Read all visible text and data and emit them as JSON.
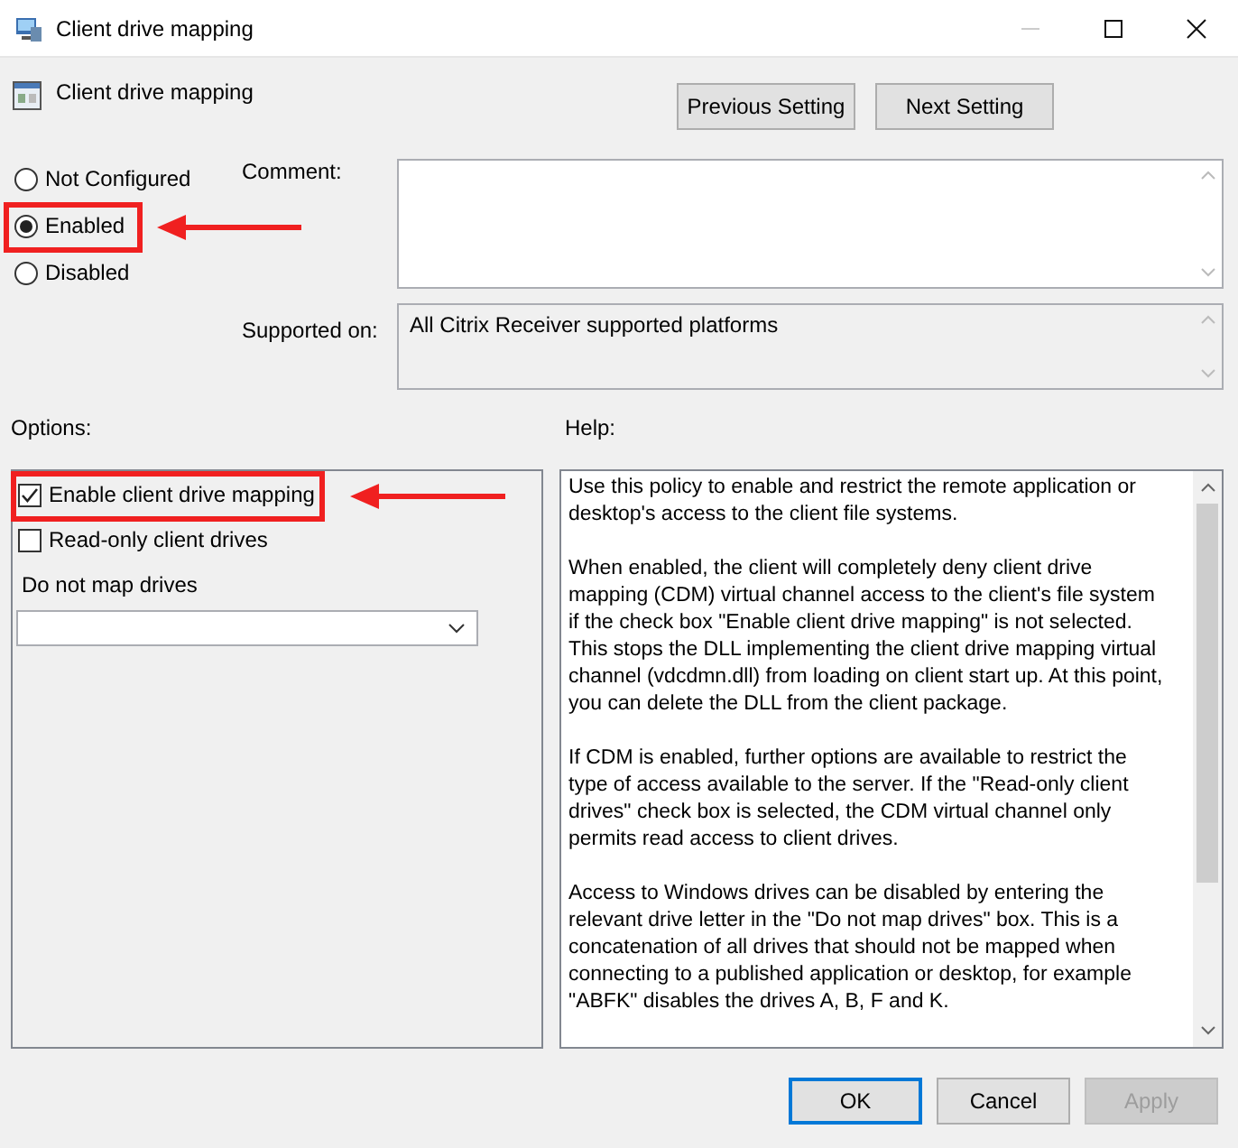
{
  "window": {
    "title": "Client drive mapping",
    "minimize_disabled": true
  },
  "policy": {
    "name": "Client drive mapping"
  },
  "nav_buttons": [
    {
      "label": "Previous Setting"
    },
    {
      "label": "Next Setting"
    }
  ],
  "state_options": [
    {
      "label": "Not Configured",
      "selected": false,
      "highlighted": false
    },
    {
      "label": "Enabled",
      "selected": true,
      "highlighted": true
    },
    {
      "label": "Disabled",
      "selected": false,
      "highlighted": false
    }
  ],
  "comment": {
    "label": "Comment:"
  },
  "supported_on": {
    "label": "Supported on:",
    "value": "All Citrix Receiver supported platforms"
  },
  "options": {
    "label": "Options:",
    "checkboxes": [
      {
        "label": "Enable client drive mapping",
        "checked": true,
        "highlighted": true
      },
      {
        "label": "Read-only client drives",
        "checked": false,
        "highlighted": false
      }
    ],
    "dropdown": {
      "label": "Do not map drives"
    }
  },
  "help": {
    "label": "Help:",
    "paragraphs": [
      "Use this policy to enable and restrict the remote application or desktop's access to the client file systems.",
      "When enabled, the client will completely deny client drive mapping (CDM) virtual channel access to the client's file system if the check box \"Enable client drive mapping\" is not selected. This stops the DLL implementing the client drive mapping virtual channel (vdcdmn.dll) from loading on client start up.  At this point, you can delete the DLL from the client package.",
      "If CDM is enabled, further options are available to restrict the type of access available to the server.  If the \"Read-only client drives\" check box is selected, the CDM virtual channel only permits read access to client drives.",
      "Access to Windows drives can be disabled by entering the relevant drive letter in the \"Do not map drives\" box.  This is a concatenation of all drives that should not be mapped when connecting to a published application or desktop, for example \"ABFK\" disables the drives A, B, F and K."
    ]
  },
  "footer_buttons": [
    {
      "label": "OK",
      "kind": "default",
      "disabled": false
    },
    {
      "label": "Cancel",
      "kind": "normal",
      "disabled": false
    },
    {
      "label": "Apply",
      "kind": "normal",
      "disabled": true
    }
  ]
}
